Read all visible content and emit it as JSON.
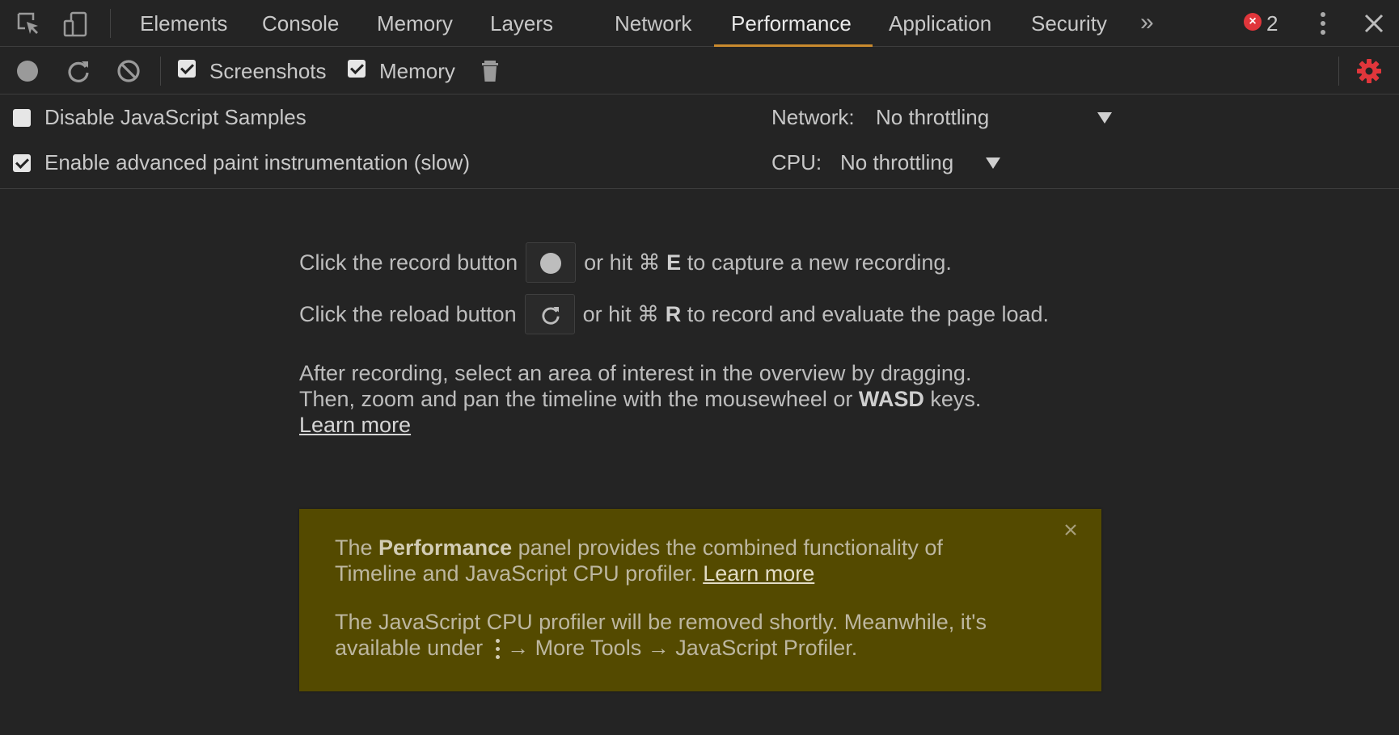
{
  "tabs": [
    {
      "label": "Elements",
      "name": "tab-elements"
    },
    {
      "label": "Console",
      "name": "tab-console"
    },
    {
      "label": "Memory",
      "name": "tab-memory"
    },
    {
      "label": "Layers",
      "name": "tab-layers"
    },
    {
      "label": "Network",
      "name": "tab-network"
    },
    {
      "label": "Performance",
      "name": "tab-performance"
    },
    {
      "label": "Application",
      "name": "tab-application"
    },
    {
      "label": "Security",
      "name": "tab-security"
    }
  ],
  "active_tab": "Performance",
  "more_tabs_glyph": "»",
  "error_count": "2",
  "toolbar": {
    "screenshots_label": "Screenshots",
    "screenshots_checked": true,
    "memory_label": "Memory",
    "memory_checked": true
  },
  "options": {
    "disable_js_samples_label": "Disable JavaScript Samples",
    "disable_js_samples_checked": false,
    "advanced_paint_label": "Enable advanced paint instrumentation (slow)",
    "advanced_paint_checked": true,
    "network_label": "Network:",
    "network_value": "No throttling",
    "cpu_label": "CPU:",
    "cpu_value": "No throttling"
  },
  "landing": {
    "record_prefix": "Click the record button",
    "record_suffix_pre": "or hit ⌘ ",
    "record_key": "E",
    "record_suffix_post": " to capture a new recording.",
    "reload_prefix": "Click the reload button",
    "reload_suffix_pre": "or hit ⌘ ",
    "reload_key": "R",
    "reload_suffix_post": " to record and evaluate the page load.",
    "hint_line1": "After recording, select an area of interest in the overview by dragging.",
    "hint_line2_pre": "Then, zoom and pan the timeline with the mousewheel or ",
    "hint_line2_key": "WASD",
    "hint_line2_post": " keys.",
    "learn_more": "Learn more"
  },
  "banner": {
    "p1_pre": "The ",
    "p1_bold": "Performance",
    "p1_post": " panel provides the combined functionality of",
    "p1_line2": "Timeline and JavaScript CPU profiler. ",
    "p1_link": "Learn more",
    "p2_line1": "The JavaScript CPU profiler will be removed shortly. Meanwhile, it's",
    "p2_line2_pre": "available under",
    "p2_line2_post": "→ More Tools → JavaScript Profiler."
  },
  "colors": {
    "background": "#242424",
    "active_tab_underline": "#c98a2e",
    "error_badge": "#e0363b",
    "settings_gear": "#e0363b",
    "banner_background": "#544a00"
  }
}
